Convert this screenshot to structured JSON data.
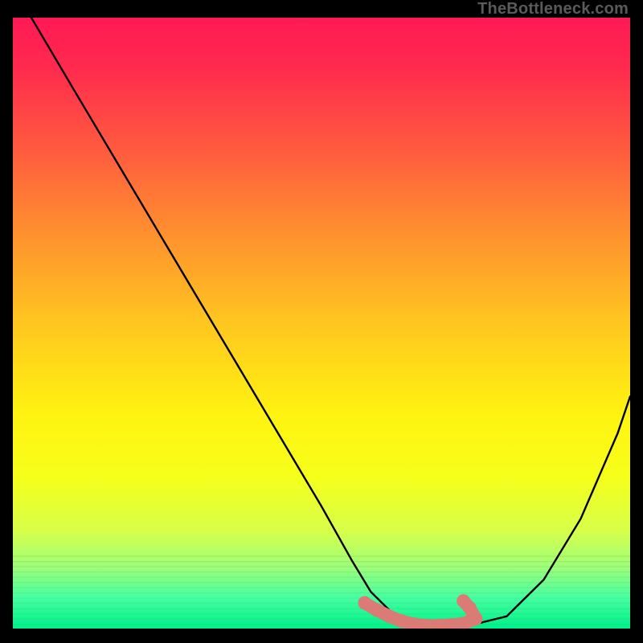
{
  "watermark": "TheBottleneck.com",
  "chart_data": {
    "type": "line",
    "title": "",
    "xlabel": "",
    "ylabel": "",
    "xlim": [
      0,
      100
    ],
    "ylim": [
      0,
      100
    ],
    "series": [
      {
        "name": "curve",
        "color": "#000000",
        "x": [
          3,
          10,
          20,
          30,
          40,
          50,
          55,
          58,
          62,
          68,
          74,
          80,
          86,
          92,
          98,
          100
        ],
        "y": [
          100,
          88,
          71,
          54,
          37,
          20,
          11,
          6,
          2,
          0.5,
          0.5,
          2,
          8,
          18,
          32,
          38
        ]
      }
    ],
    "markers": {
      "name": "highlight-region",
      "color": "#db7b75",
      "x": [
        57,
        59,
        61,
        63,
        65,
        67,
        69,
        71,
        73,
        75,
        74,
        73
      ],
      "y": [
        4.2,
        3.0,
        2.0,
        1.2,
        0.7,
        0.5,
        0.5,
        0.6,
        0.8,
        1.6,
        3.4,
        4.5
      ]
    },
    "background_gradient": {
      "stops": [
        {
          "pos": 0,
          "color": "#ff1955"
        },
        {
          "pos": 22,
          "color": "#ff5c3e"
        },
        {
          "pos": 50,
          "color": "#ffc61f"
        },
        {
          "pos": 75,
          "color": "#f6ff1a"
        },
        {
          "pos": 100,
          "color": "#00f08a"
        }
      ]
    }
  }
}
